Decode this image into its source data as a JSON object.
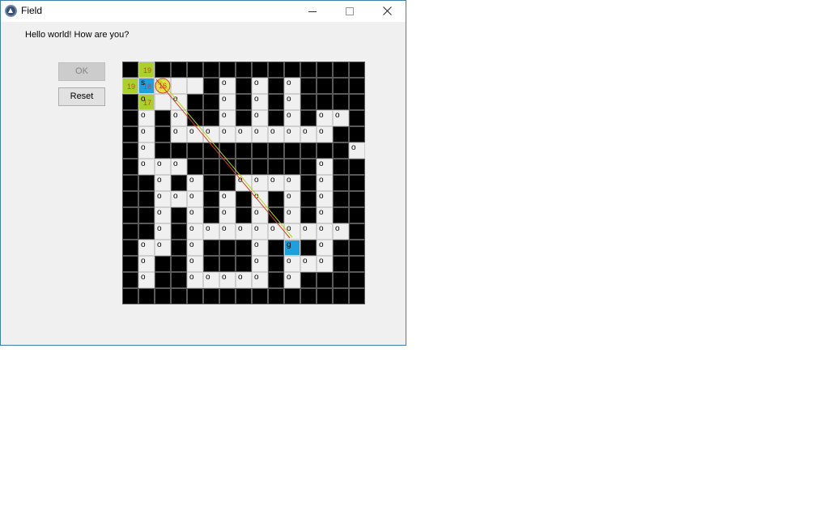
{
  "window": {
    "title": "Field",
    "close_glyph": "×",
    "icons": [
      "app-icon",
      "minimize-icon",
      "maximize-icon",
      "close-icon"
    ]
  },
  "main": {
    "greeting": "Hello world! How are you?",
    "ok_label": "OK",
    "reset_label": "Reset"
  },
  "grid": {
    "rows": [
      "###############",
      "#.o..#o#o#o####",
      "#o.o##o#o#o####",
      "#o#o##o#o#o#oo#",
      "#o#oooooooooo##",
      "#o############o#",
      "#ooo########o##",
      "##o#o##oooo#o##",
      "##ooo#o#o#o#o##",
      "##o#o#o#o#o#o##",
      "##o#oooooooooo#",
      "#oo#o###o#o#o##",
      "#o##o###o#ooo##",
      "#o##ooooo#o####",
      "###############"
    ],
    "legend": {
      "#": "wall",
      "o": "open",
      ".": "open"
    },
    "open_mark": "o",
    "visited": [
      {
        "row": 0,
        "col": 1,
        "value": "19"
      },
      {
        "row": 1,
        "col": 0,
        "value": "19"
      },
      {
        "row": 2,
        "col": 1,
        "value": "17"
      }
    ],
    "current": {
      "row": 1,
      "col": 1,
      "value": "18",
      "mark": "s"
    },
    "target": {
      "row": 1,
      "col": 2,
      "value": "16"
    },
    "goal": {
      "row": 11,
      "col": 10,
      "mark": "g"
    },
    "path_colors": [
      "#d2402a",
      "#b8d21f"
    ],
    "colors": {
      "wall": "#000000",
      "open": "#f0f0f0",
      "visited": "#acd02a",
      "current": "#1e9fde",
      "number": "#d2402a"
    }
  }
}
